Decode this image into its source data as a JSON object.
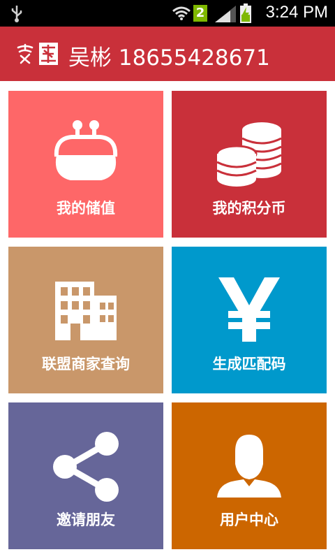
{
  "status_bar": {
    "time": "3:24 PM",
    "notification_count": "2",
    "icons": [
      "usb-icon",
      "wifi-icon",
      "notification-badge",
      "signal-icon",
      "battery-charging-icon"
    ]
  },
  "header": {
    "logo_text": "富星",
    "title": "吴彬 18655428671",
    "background": "#c9303a"
  },
  "tiles": [
    {
      "label": "我的储值",
      "icon": "purse-icon",
      "color": "#fe6768"
    },
    {
      "label": "我的积分币",
      "icon": "coins-icon",
      "color": "#c9303a"
    },
    {
      "label": "联盟商家查询",
      "icon": "building-icon",
      "color": "#c9976a"
    },
    {
      "label": "生成匹配码",
      "icon": "yen-icon",
      "color": "#0099cc"
    },
    {
      "label": "邀请朋友",
      "icon": "share-icon",
      "color": "#666699"
    },
    {
      "label": "用户中心",
      "icon": "user-icon",
      "color": "#cc6600"
    }
  ]
}
